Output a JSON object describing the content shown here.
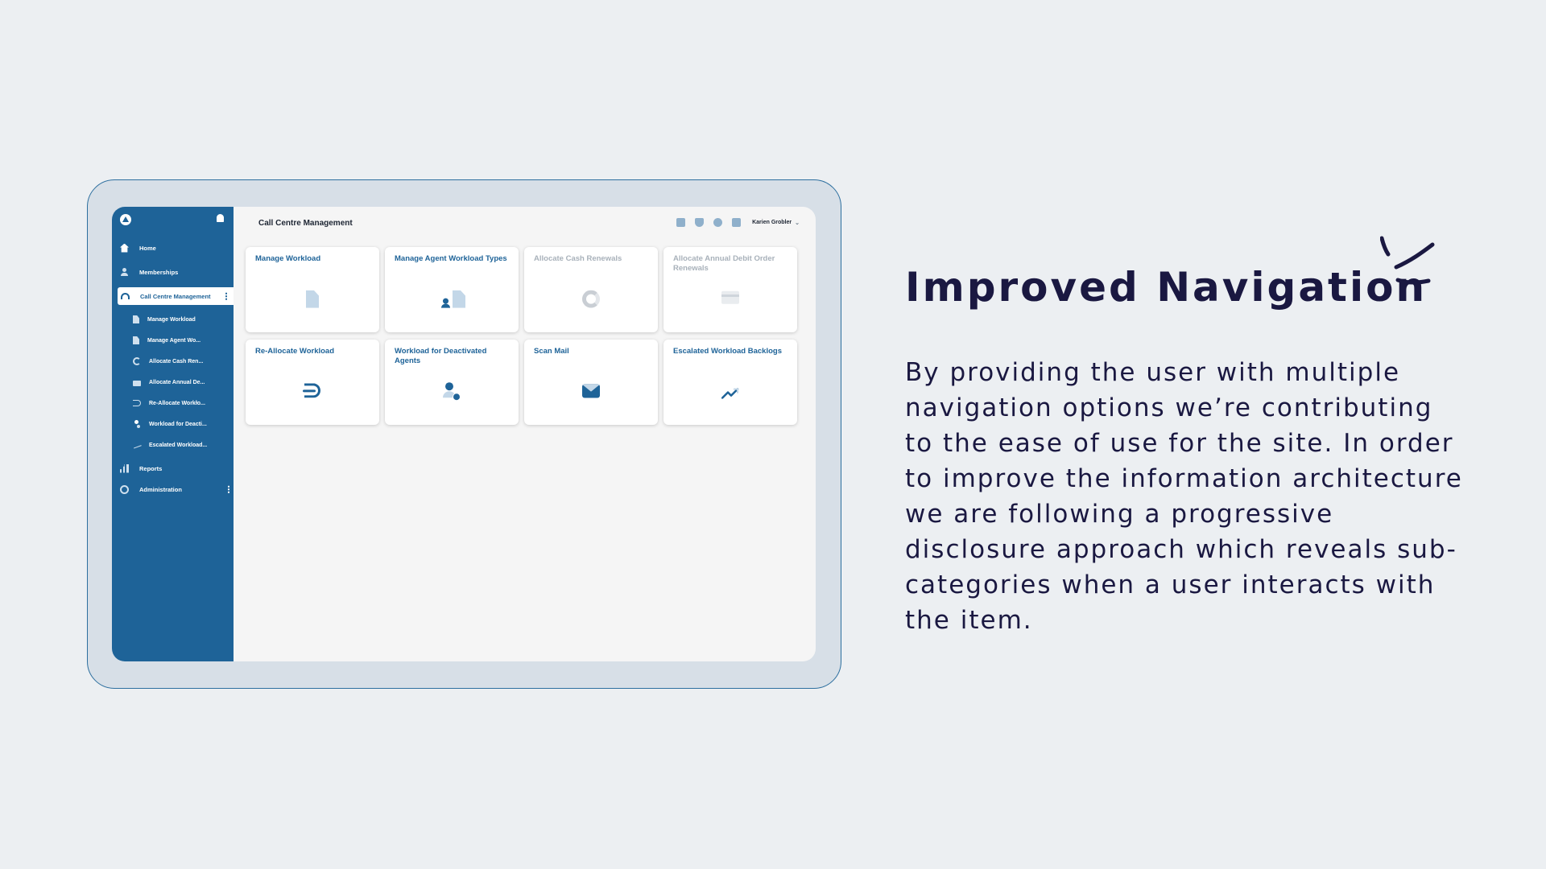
{
  "sidebar": {
    "items": [
      {
        "label": "Home",
        "icon": "home-icon"
      },
      {
        "label": "Memberships",
        "icon": "person-icon"
      },
      {
        "label": "Call Centre Management",
        "icon": "headset-icon"
      },
      {
        "label": "Reports",
        "icon": "bar-chart-icon"
      },
      {
        "label": "Administration",
        "icon": "gear-icon"
      }
    ],
    "subitems": [
      {
        "label": "Manage Workload",
        "icon": "document-icon"
      },
      {
        "label": "Manage Agent Wo...",
        "icon": "document-person-icon"
      },
      {
        "label": "Allocate Cash Ren...",
        "icon": "ring-icon"
      },
      {
        "label": "Allocate Annual De...",
        "icon": "card-icon"
      },
      {
        "label": "Re-Allocate Workło...",
        "icon": "swap-icon"
      },
      {
        "label": "Workload for Deacti...",
        "icon": "agent-icon"
      },
      {
        "label": "Escalated Workload...",
        "icon": "trend-icon"
      }
    ]
  },
  "header": {
    "title": "Call Centre Management",
    "user": "Karien Grobler"
  },
  "tiles": [
    {
      "label": "Manage Workload",
      "icon": "document-icon",
      "enabled": true
    },
    {
      "label": "Manage Agent Workload Types",
      "icon": "document-person-icon",
      "enabled": true
    },
    {
      "label": "Allocate Cash Renewals",
      "icon": "ring-icon",
      "enabled": false
    },
    {
      "label": "Allocate Annual Debit Order Renewals",
      "icon": "card-icon",
      "enabled": false
    },
    {
      "label": "Re-Allocate Workload",
      "icon": "swap-icon",
      "enabled": true
    },
    {
      "label": "Workload for Deactivated Agents",
      "icon": "agent-icon",
      "enabled": true
    },
    {
      "label": "Scan Mail",
      "icon": "mail-icon",
      "enabled": true
    },
    {
      "label": "Escalated Workload Backlogs",
      "icon": "trend-icon",
      "enabled": true
    }
  ],
  "copy": {
    "headline": "Improved Navigation",
    "body": "By providing the user with multiple navigation options we’re contributing to the ease of use for the site. In order to improve the information architecture we are following a progressive disclosure approach which reveals sub-categories when a user interacts with the item."
  },
  "colors": {
    "brand_blue": "#1e6398",
    "headline_navy": "#1a1841",
    "background": "#eceff2"
  }
}
